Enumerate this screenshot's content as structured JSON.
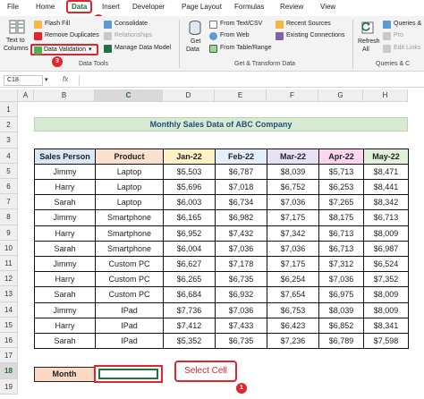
{
  "ribbon_tabs": {
    "file": "File",
    "home": "Home",
    "data": "Data",
    "insert": "Insert",
    "developer": "Developer",
    "page_layout": "Page Layout",
    "formulas": "Formulas",
    "review": "Review",
    "view": "View"
  },
  "steps": {
    "one": "1",
    "two": "2",
    "three": "3"
  },
  "ribbon": {
    "text_to_columns_1": "Text to",
    "text_to_columns_2": "Columns",
    "flash_fill": "Flash Fill",
    "remove_duplicates": "Remove Duplicates",
    "data_validation": "Data Validation",
    "consolidate": "Consolidate",
    "relationships": "Relationships",
    "manage_data_model": "Manage Data Model",
    "get_data_1": "Get",
    "get_data_2": "Data",
    "from_text_csv": "From Text/CSV",
    "from_web": "From Web",
    "from_table_range": "From Table/Range",
    "recent_sources": "Recent Sources",
    "existing_connections": "Existing Connections",
    "refresh_all_1": "Refresh",
    "refresh_all_2": "All",
    "queries_connections": "Queries &",
    "properties": "Pro",
    "edit_links": "Edit Links",
    "group_data_tools": "Data Tools",
    "group_get_transform": "Get & Transform Data",
    "group_queries": "Queries & C"
  },
  "formula_bar": {
    "name_box": "C18",
    "fx": "fx",
    "value": ""
  },
  "columns": [
    "A",
    "B",
    "C",
    "D",
    "E",
    "F",
    "G",
    "H"
  ],
  "rows": [
    "1",
    "2",
    "3",
    "4",
    "5",
    "6",
    "7",
    "8",
    "9",
    "10",
    "11",
    "12",
    "13",
    "14",
    "15",
    "16",
    "17",
    "18",
    "19"
  ],
  "selected": {
    "column": "C",
    "row": "18"
  },
  "sheet": {
    "title": "Monthly Sales Data of ABC Company",
    "headers": [
      "Sales Person",
      "Product",
      "Jan-22",
      "Feb-22",
      "Mar-22",
      "Apr-22",
      "May-22"
    ],
    "header_colors": [
      "#dae8f5",
      "#fbe0d0",
      "#fdf1c6",
      "#e4eefb",
      "#e8e1f5",
      "#fbd6ee",
      "#e2efd9"
    ],
    "data_rows": [
      [
        "Jimmy",
        "Laptop",
        "$5,503",
        "$6,787",
        "$8,039",
        "$5,713",
        "$8,471"
      ],
      [
        "Harry",
        "Laptop",
        "$5,696",
        "$7,018",
        "$6,752",
        "$6,253",
        "$8,441"
      ],
      [
        "Sarah",
        "Laptop",
        "$6,003",
        "$6,734",
        "$7,036",
        "$7,265",
        "$8,342"
      ],
      [
        "Jimmy",
        "Smartphone",
        "$6,165",
        "$6,982",
        "$7,175",
        "$8,175",
        "$6,713"
      ],
      [
        "Harry",
        "Smartphone",
        "$6,952",
        "$7,432",
        "$7,342",
        "$6,713",
        "$8,009"
      ],
      [
        "Sarah",
        "Smartphone",
        "$6,004",
        "$7,036",
        "$7,036",
        "$6,713",
        "$6,987"
      ],
      [
        "Jimmy",
        "Custom PC",
        "$6,627",
        "$7,178",
        "$7,175",
        "$7,312",
        "$6,524"
      ],
      [
        "Harry",
        "Custom PC",
        "$6,265",
        "$6,735",
        "$6,254",
        "$7,036",
        "$7,352"
      ],
      [
        "Sarah",
        "Custom PC",
        "$6,684",
        "$6,932",
        "$7,654",
        "$6,975",
        "$8,009"
      ],
      [
        "Jimmy",
        "IPad",
        "$7,736",
        "$7,036",
        "$6,753",
        "$8,039",
        "$8,009"
      ],
      [
        "Harry",
        "IPad",
        "$7,412",
        "$7,433",
        "$6,423",
        "$6,852",
        "$8,341"
      ],
      [
        "Sarah",
        "IPad",
        "$5,352",
        "$6,735",
        "$7,236",
        "$6,789",
        "$7,598"
      ]
    ],
    "month_label": "Month",
    "month_value": ""
  },
  "callout": {
    "text": "Select Cell"
  },
  "colors": {
    "accent_red": "#e0262c",
    "excel_green": "#217346"
  }
}
